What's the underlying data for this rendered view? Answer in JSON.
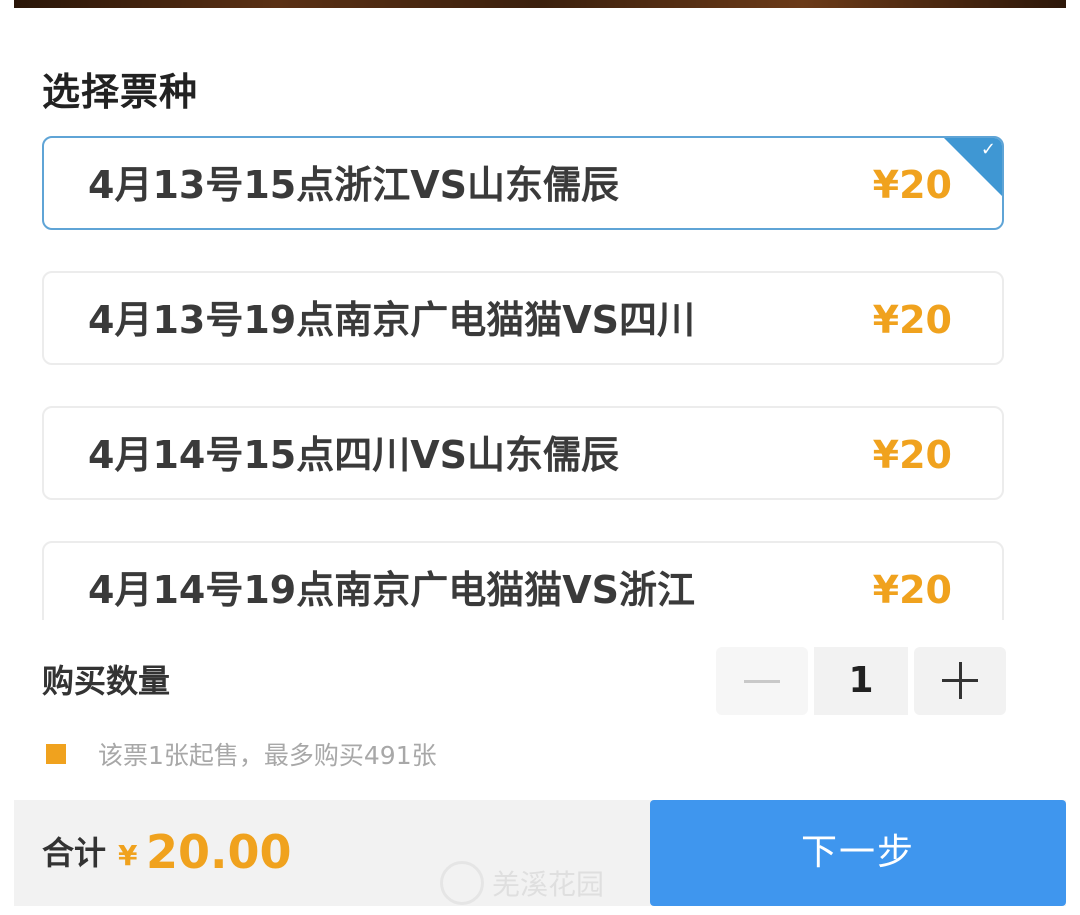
{
  "section": {
    "title": "选择票种"
  },
  "tickets": [
    {
      "name": "4月13号15点浙江VS山东儒辰",
      "price": "¥20",
      "selected": true
    },
    {
      "name": "4月13号19点南京广电猫猫VS四川",
      "price": "¥20",
      "selected": false
    },
    {
      "name": "4月14号15点四川VS山东儒辰",
      "price": "¥20",
      "selected": false
    },
    {
      "name": "4月14号19点南京广电猫猫VS浙江",
      "price": "¥20",
      "selected": false
    }
  ],
  "selection_badge": {
    "icon": "check-icon",
    "glyph": "✓"
  },
  "quantity": {
    "label": "购买数量",
    "value": "1",
    "decrement_icon": "minus-icon",
    "increment_icon": "plus-icon"
  },
  "notice": {
    "text": "该票1张起售，最多购买491张"
  },
  "footer": {
    "total_label": "合计",
    "currency": "¥",
    "total_amount": "20.00",
    "next_label": "下一步"
  },
  "watermark": {
    "text": "羌溪花园"
  },
  "colors": {
    "accent_orange": "#f0a21e",
    "primary_blue": "#3f96ee",
    "selected_border": "#5fa4d6",
    "badge_blue": "#3f97d3"
  }
}
